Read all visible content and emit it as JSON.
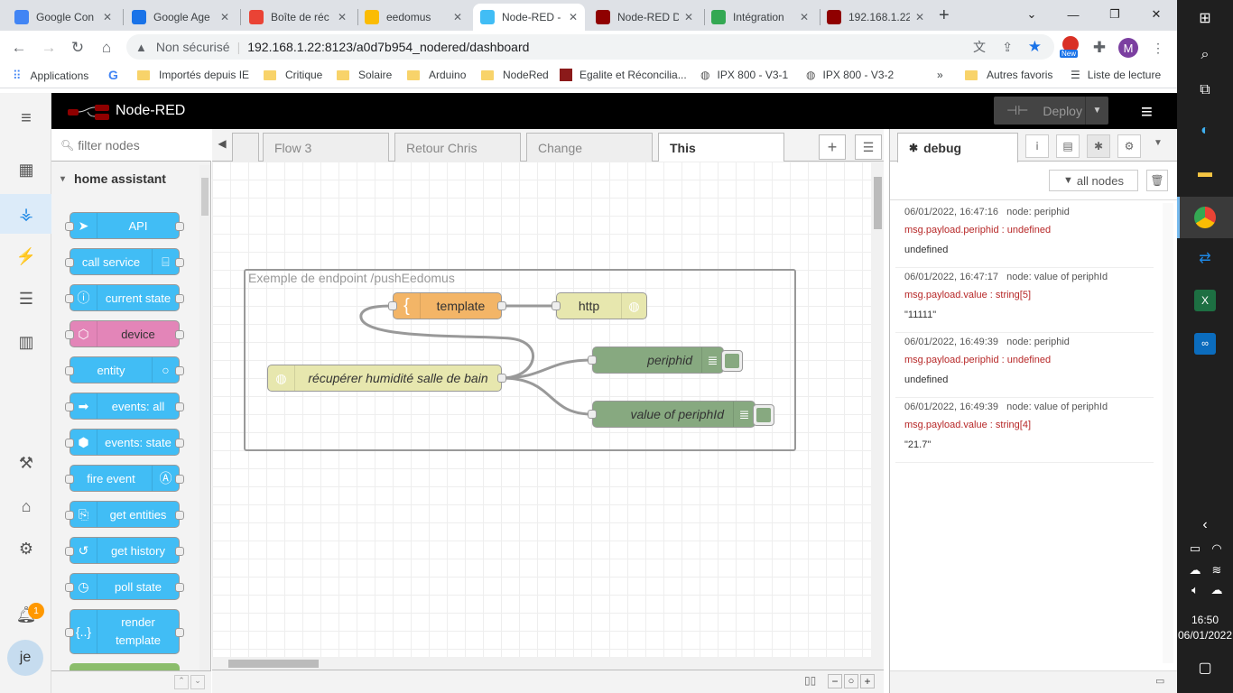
{
  "browser": {
    "tabs": [
      {
        "title": "Google Con",
        "active": false,
        "color": "#4285f4"
      },
      {
        "title": "Google Age",
        "active": false,
        "color": "#1a73e8"
      },
      {
        "title": "Boîte de réc",
        "active": false,
        "color": "#ea4335"
      },
      {
        "title": "eedomus",
        "active": false,
        "color": "#fbbc04"
      },
      {
        "title": "Node-RED -",
        "active": true,
        "color": "#41bdf5"
      },
      {
        "title": "Node-RED D",
        "active": false,
        "color": "#8f0000"
      },
      {
        "title": "Intégration",
        "active": false,
        "color": "#34a853"
      },
      {
        "title": "192.168.1.22",
        "active": false,
        "color": "#8f0000"
      }
    ],
    "url_secure_label": "Non sécurisé",
    "url": "192.168.1.22:8123/a0d7b954_nodered/dashboard",
    "profile_initial": "M",
    "new_badge": "New",
    "bookmarks": {
      "apps": "Applications",
      "items": [
        "Importés depuis IE",
        "Critique",
        "Solaire",
        "Arduino",
        "NodeRed",
        "Egalite et Réconcilia...",
        "IPX 800 - V3-1",
        "IPX 800 - V3-2"
      ],
      "overflow": "»",
      "other": "Autres favoris",
      "reading": "Liste de lecture"
    }
  },
  "nodered": {
    "title": "Node-RED",
    "deploy_label": "Deploy",
    "filter_placeholder": "filter nodes",
    "palette_category": "home assistant",
    "palette_nodes": [
      {
        "label": "API",
        "color": "#41bdf5",
        "icon": "paper-plane-icon",
        "glyph": "➤"
      },
      {
        "label": "call service",
        "color": "#41bdf5",
        "icon": "router-icon",
        "glyph": "⌸"
      },
      {
        "label": "current state",
        "color": "#41bdf5",
        "icon": "info-icon",
        "glyph": "ⓘ"
      },
      {
        "label": "device",
        "color": "#e385b8",
        "icon": "cube-icon",
        "glyph": "⬡"
      },
      {
        "label": "entity",
        "color": "#41bdf5",
        "icon": "circle-icon",
        "glyph": "○"
      },
      {
        "label": "events: all",
        "color": "#41bdf5",
        "icon": "arrow-icon",
        "glyph": "➡"
      },
      {
        "label": "events: state",
        "color": "#41bdf5",
        "icon": "state-icon",
        "glyph": "⬢"
      },
      {
        "label": "fire event",
        "color": "#41bdf5",
        "icon": "antenna-icon",
        "glyph": "Ⓐ"
      },
      {
        "label": "get entities",
        "color": "#41bdf5",
        "icon": "search-doc-icon",
        "glyph": "⎘"
      },
      {
        "label": "get history",
        "color": "#41bdf5",
        "icon": "history-icon",
        "glyph": "↺"
      },
      {
        "label": "poll state",
        "color": "#41bdf5",
        "icon": "timer-icon",
        "glyph": "◷"
      },
      {
        "label": "render template",
        "color": "#41bdf5",
        "icon": "braces-icon",
        "glyph": "{..}"
      }
    ],
    "workspace_tabs": [
      "Flow 3",
      "Retour Chris",
      "Change",
      "This"
    ],
    "active_tab": "This",
    "group_label": "Exemple de endpoint /pushEedomus",
    "nodes": {
      "template": "template",
      "http": "http",
      "recuperer": "récupérer humidité salle de bain",
      "periphid": "periphid",
      "value": "value of periphId"
    },
    "sidebar": {
      "tab_label": "debug",
      "filter_label": "all nodes",
      "messages": [
        {
          "time": "06/01/2022, 16:47:16",
          "node": "node: periphid",
          "path": "msg.payload.periphid : undefined",
          "value": "undefined",
          "kind": "undef"
        },
        {
          "time": "06/01/2022, 16:47:17",
          "node": "node: value of periphId",
          "path": "msg.payload.value : string[5]",
          "value": "\"11111\"",
          "kind": "string"
        },
        {
          "time": "06/01/2022, 16:49:39",
          "node": "node: periphid",
          "path": "msg.payload.periphid : undefined",
          "value": "undefined",
          "kind": "undef"
        },
        {
          "time": "06/01/2022, 16:49:39",
          "node": "node: value of periphId",
          "path": "msg.payload.value : string[4]",
          "value": "\"21.7\"",
          "kind": "string"
        }
      ]
    },
    "notification_count": "1",
    "user_initials": "je"
  },
  "taskbar": {
    "time": "16:50",
    "date": "06/01/2022"
  }
}
